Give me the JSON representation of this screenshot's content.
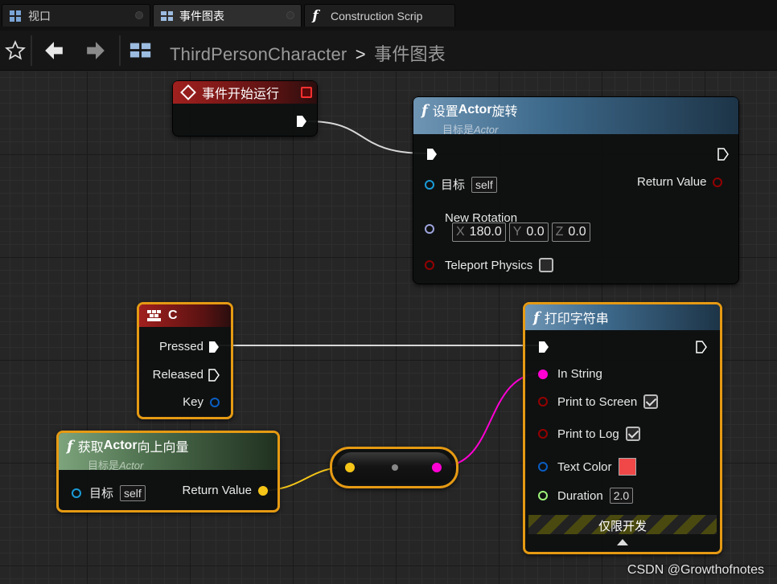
{
  "tabs": [
    {
      "label": "视口",
      "icon": "viewport-icon"
    },
    {
      "label": "事件图表",
      "icon": "event-graph-icon"
    },
    {
      "label": "Construction Scrip",
      "icon": "function-icon"
    }
  ],
  "breadcrumb": {
    "root": "ThirdPersonCharacter",
    "separator": ">",
    "current": "事件图表"
  },
  "nodes": {
    "begin_play": {
      "title": "事件开始运行"
    },
    "set_rotation": {
      "title_prefix": "设置",
      "title_bold": "Actor",
      "title_suffix": "旋转",
      "subtitle_prefix": "目标是",
      "subtitle_italic": "Actor",
      "target_label": "目标",
      "target_value": "self",
      "return_label": "Return Value",
      "rotation_label": "New Rotation",
      "x_label": "X",
      "x_value": "180.0",
      "y_label": "Y",
      "y_value": "0.0",
      "z_label": "Z",
      "z_value": "0.0",
      "teleport_label": "Teleport Physics"
    },
    "key_c": {
      "title": "C",
      "pressed": "Pressed",
      "released": "Released",
      "key": "Key"
    },
    "print_string": {
      "title": "打印字符串",
      "in_string": "In String",
      "print_screen": "Print to Screen",
      "print_log": "Print to Log",
      "text_color": "Text Color",
      "duration": "Duration",
      "duration_value": "2.0",
      "dev_only": "仅限开发"
    },
    "get_up_vector": {
      "title_prefix": "获取",
      "title_bold": "Actor",
      "title_suffix": "向上向量",
      "subtitle_prefix": "目标是",
      "subtitle_italic": "Actor",
      "target_label": "目标",
      "target_value": "self",
      "return_label": "Return Value"
    }
  },
  "colors": {
    "exec": "#ffffff",
    "object": "#1a9bd7",
    "rotator": "#9ea4dd",
    "bool": "#950000",
    "string": "#ff00d4",
    "vector": "#f5c518",
    "struct_color": "#0a5dc2",
    "float": "#9ef27a",
    "selection": "#e59a13",
    "text_color_swatch": "#f04848"
  },
  "watermark": "CSDN @Growthofnotes"
}
